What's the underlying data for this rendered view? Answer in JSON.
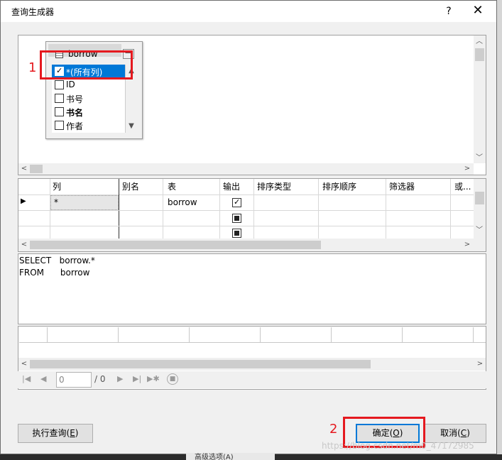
{
  "dialog": {
    "title": "查询生成器",
    "help_label": "?",
    "close_label": "✕"
  },
  "diagram": {
    "table_name": "borrow",
    "columns": [
      {
        "label": "*(所有列)",
        "checked": true,
        "selected": true,
        "bold": false
      },
      {
        "label": "ID",
        "checked": false,
        "selected": false,
        "bold": false
      },
      {
        "label": "书号",
        "checked": false,
        "selected": false,
        "bold": false
      },
      {
        "label": "书名",
        "checked": false,
        "selected": false,
        "bold": true
      },
      {
        "label": "作者",
        "checked": false,
        "selected": false,
        "bold": false
      }
    ],
    "minimize_label": "—",
    "annotation_number": "1"
  },
  "grid": {
    "headers": [
      "列",
      "别名",
      "表",
      "输出",
      "排序类型",
      "排序顺序",
      "筛选器",
      "或..."
    ],
    "row_marker": "▶",
    "rows": [
      {
        "column": "*",
        "alias": "",
        "table": "borrow",
        "output": "checked"
      },
      {
        "column": "",
        "alias": "",
        "table": "",
        "output": "partial"
      },
      {
        "column": "",
        "alias": "",
        "table": "",
        "output": "partial"
      }
    ]
  },
  "sql": {
    "lines": [
      "SELECT   borrow.*",
      "FROM      borrow"
    ]
  },
  "navigator": {
    "first_icon": "first-record-icon",
    "prev_icon": "previous-record-icon",
    "current": "0",
    "total": "/ 0",
    "next_icon": "next-record-icon",
    "last_icon": "last-record-icon",
    "new_icon": "new-record-icon",
    "stop_icon": "stop-icon"
  },
  "buttons": {
    "execute": "执行查询(",
    "execute_key": "E",
    "execute_end": ")",
    "ok": "确定(",
    "ok_key": "O",
    "ok_end": ")",
    "cancel": "取消(",
    "cancel_key": "C",
    "cancel_end": ")",
    "annotation_number": "2"
  },
  "background": {
    "tab_label": "高级选项(A)",
    "watermark": "https://blog.csdn.net/m0_47172985"
  },
  "colors": {
    "selection": "#0078d7",
    "annotation": "#e5191f",
    "dialog_bg": "#f0f0f0"
  }
}
